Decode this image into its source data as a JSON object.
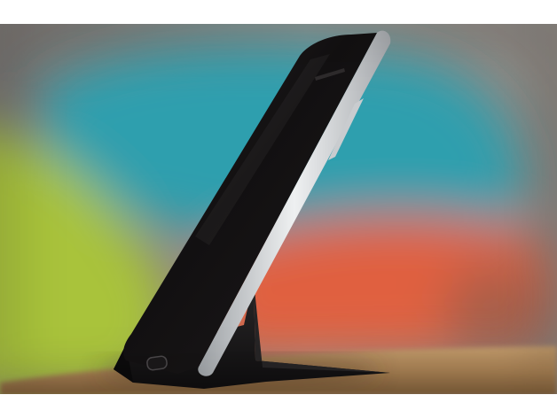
{
  "image": {
    "subject": "smartphone-on-stand",
    "colors": {
      "letterbox": "#ffffff",
      "backdrop": "#8f8a86",
      "cushion_teal": "#2f9fae",
      "cushion_green": "#a9c33a",
      "cushion_orange": "#e0603f",
      "table_wood": "#b08a5e",
      "stand": "#1c1b1c",
      "phone_body": "#141213",
      "phone_frame": "#d6d8da"
    }
  }
}
